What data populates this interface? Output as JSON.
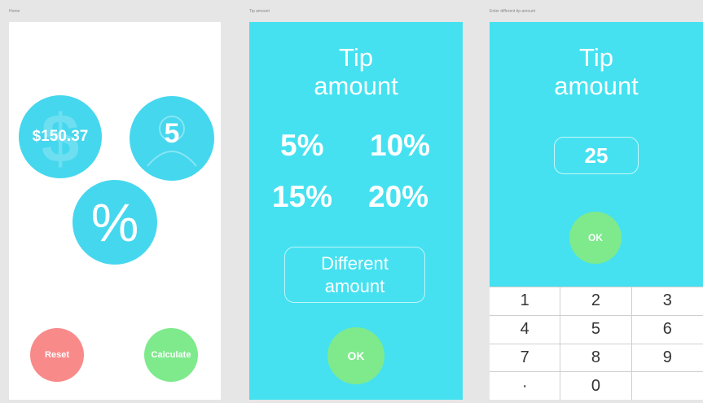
{
  "captions": {
    "screen1": "Home",
    "screen2": "Tip amount",
    "screen3": "Enter different tip amount"
  },
  "home": {
    "bill_amount": "$150.37",
    "people_count": "5",
    "percent_symbol": "%",
    "reset_label": "Reset",
    "calculate_label": "Calculate"
  },
  "tip_screen": {
    "title_line1": "Tip",
    "title_line2": "amount",
    "options": [
      "5%",
      "10%",
      "15%",
      "20%"
    ],
    "different_line1": "Different",
    "different_line2": "amount",
    "ok_label": "OK"
  },
  "custom_screen": {
    "title_line1": "Tip",
    "title_line2": "amount",
    "amount_value": "25",
    "ok_label": "OK",
    "keypad": [
      "1",
      "2",
      "3",
      "4",
      "5",
      "6",
      "7",
      "8",
      "9",
      "·",
      "0",
      ""
    ]
  },
  "colors": {
    "accent": "#45e1f0",
    "bubble": "#45d7ee",
    "reset": "#f88a8a",
    "calculate": "#7eea8c"
  }
}
